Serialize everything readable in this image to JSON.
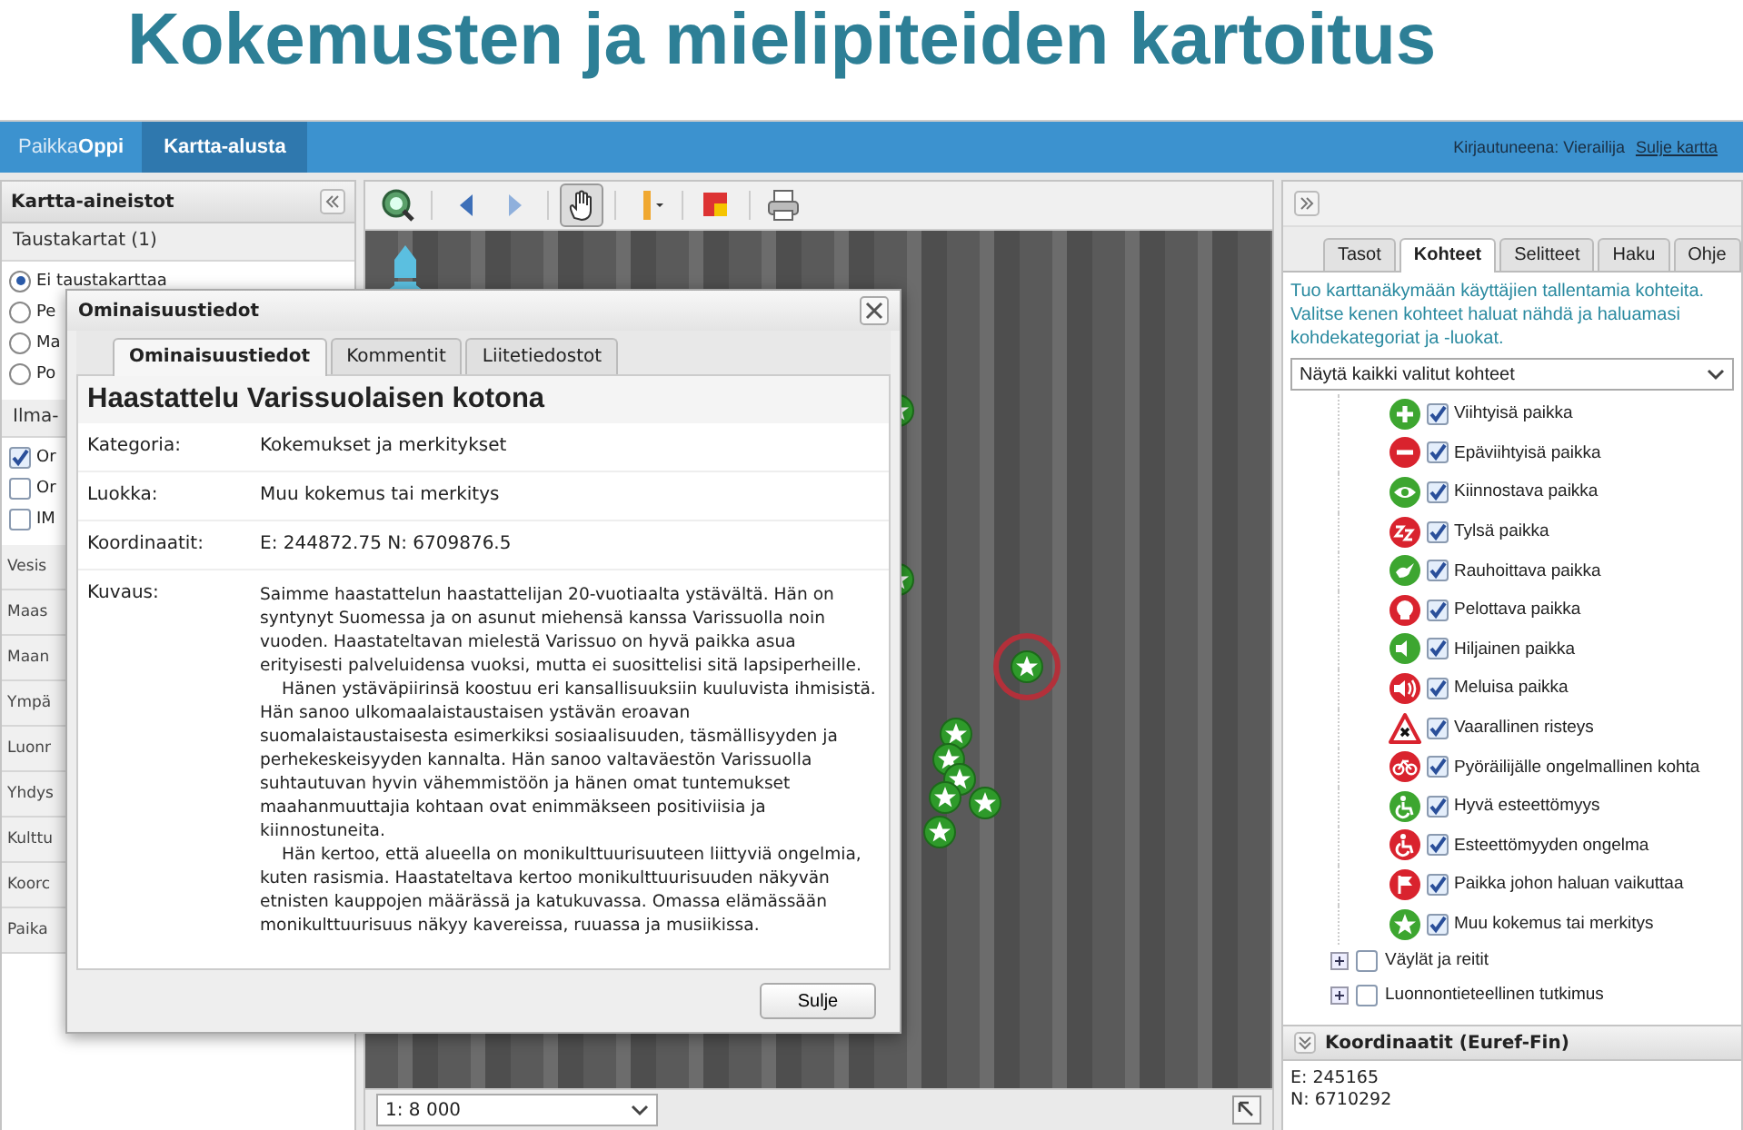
{
  "slide_title": "Kokemusten ja mielipiteiden kartoitus",
  "header": {
    "brand": "Paikka**Oppi**",
    "tab": {
      "label": "Kartta-alusta",
      "selected": true
    },
    "user_label": "Kirjautuneena: Vierailija",
    "close_link": "Sulje kartta"
  },
  "left_panel": {
    "title": "Kartta-aineistot",
    "background_maps": {
      "title": "Taustakartat (1)",
      "options": [
        {
          "label": "Ei taustakarttaa",
          "selected": true
        },
        {
          "label": "Pe",
          "selected": false
        },
        {
          "label": "Ma",
          "selected": false
        },
        {
          "label": "Po",
          "selected": false
        }
      ]
    },
    "aerial": {
      "title": "Ilma-",
      "layers": [
        {
          "label": "Or",
          "checked": true
        },
        {
          "label": "Or",
          "checked": false
        },
        {
          "label": "IM",
          "checked": false
        }
      ]
    },
    "groups": [
      "Vesis",
      "Maas",
      "Maan",
      "Ympä",
      "Luonr",
      "Yhdys",
      "Kulttu",
      "Koorc",
      "Paika"
    ]
  },
  "map": {
    "tools": [
      {
        "selected": false
      },
      {
        "selected": false
      },
      {
        "selected": false
      },
      {
        "selected": true
      },
      {
        "selected": false
      },
      {
        "selected": false
      },
      {
        "selected": false
      }
    ],
    "scale": "1: 8 000"
  },
  "dialog": {
    "title": "Ominaisuustiedot",
    "tabs": [
      {
        "label": "Ominaisuustiedot",
        "selected": true
      },
      {
        "label": "Kommentit",
        "selected": false
      },
      {
        "label": "Liitetiedostot",
        "selected": false
      }
    ],
    "heading": "Haastattelu Varissuolaisen kotona",
    "fields": [
      {
        "label": "Kategoria:",
        "value": "Kokemukset ja merkitykset"
      },
      {
        "label": "Luokka:",
        "value": "Muu kokemus tai merkitys"
      },
      {
        "label": "Koordinaatit:",
        "value": "E: 244872.75 N: 6709876.5"
      }
    ],
    "description_label": "Kuvaus:",
    "description": [
      "Saimme haastattelun haastattelijan 20-vuotiaalta ystävältä. Hän on syntynyt Suomessa ja on asunut miehensä kanssa Varissuolla noin vuoden. Haastateltavan mielestä Varissuo on hyvä paikka asua erityisesti palveluidensa vuoksi, mutta ei suosittelisi sitä lapsiperheille.",
      "Hänen ystäväpiirinsä koostuu eri kansallisuuksiin kuuluvista ihmisistä. Hän sanoo ulkomaalaistaustaisen ystävän eroavan suomalaistaustaisesta esimerkiksi sosiaalisuuden, täsmällisyyden ja perhekeskeisyyden kannalta. Hän sanoo valtaväestön Varissuolla suhtautuvan hyvin vähemmistöön ja hänen omat tuntemukset maahanmuuttajia kohtaan ovat enimmäkseen positiviisia ja kiinnostuneita.",
      "Hän kertoo, että alueella on monikulttuurisuuteen liittyviä ongelmia, kuten rasismia. Haastateltava kertoo monikulttuurisuuden näkyvän etnisten kauppojen määrässä ja katukuvassa. Omassa elämässään monikulttuurisuus näkyy kavereissa, ruuassa ja musiikissa."
    ],
    "close_button": "Sulje"
  },
  "right_panel": {
    "tabs": [
      {
        "label": "Tasot",
        "selected": false
      },
      {
        "label": "Kohteet",
        "selected": true
      },
      {
        "label": "Selitteet",
        "selected": false
      },
      {
        "label": "Haku",
        "selected": false
      },
      {
        "label": "Ohje",
        "selected": false
      }
    ],
    "info": "Tuo karttanäkymään käyttäjien tallentamia kohteita. Valitse kenen kohteet haluat nähdä ja haluamasi kohdekategoriat ja -luokat.",
    "filter": "Näytä kaikki valitut kohteet",
    "layers": [
      {
        "label": "Viihtyisä paikka",
        "kind": "circle",
        "color": "#3da630",
        "checked": true
      },
      {
        "label": "Epäviihtyisä paikka",
        "kind": "circle",
        "color": "#d9232e",
        "checked": true
      },
      {
        "label": "Kiinnostava paikka",
        "kind": "circle",
        "color": "#3da630",
        "checked": true
      },
      {
        "label": "Tylsä paikka",
        "kind": "circle",
        "color": "#d9232e",
        "checked": true
      },
      {
        "label": "Rauhoittava paikka",
        "kind": "circle",
        "color": "#3da630",
        "checked": true
      },
      {
        "label": "Pelottava paikka",
        "kind": "circle",
        "color": "#d9232e",
        "checked": true
      },
      {
        "label": "Hiljainen paikka",
        "kind": "circle",
        "color": "#3da630",
        "checked": true
      },
      {
        "label": "Meluisa paikka",
        "kind": "circle",
        "color": "#d9232e",
        "checked": true
      },
      {
        "label": "Vaarallinen risteys",
        "kind": "triangle",
        "color": "#d9232e",
        "checked": true
      },
      {
        "label": "Pyöräilijälle ongelmallinen kohta",
        "kind": "circle",
        "color": "#d9232e",
        "checked": true
      },
      {
        "label": "Hyvä esteettömyys",
        "kind": "circle",
        "color": "#3da630",
        "checked": true
      },
      {
        "label": "Esteettömyyden ongelma",
        "kind": "circle",
        "color": "#d9232e",
        "checked": true
      },
      {
        "label": "Paikka johon haluan vaikuttaa",
        "kind": "circle",
        "color": "#d9232e",
        "checked": true
      },
      {
        "label": "Muu kokemus tai merkitys",
        "kind": "circle",
        "color": "#3da630",
        "checked": true
      }
    ],
    "groups": [
      {
        "label": "Väylät ja reitit",
        "checked": false
      },
      {
        "label": "Luonnontieteellinen tutkimus",
        "checked": false
      }
    ],
    "coordinates": {
      "title": "Koordinaatit (Euref-Fin)",
      "e": "E: 245165",
      "n": "N: 6710292"
    }
  }
}
